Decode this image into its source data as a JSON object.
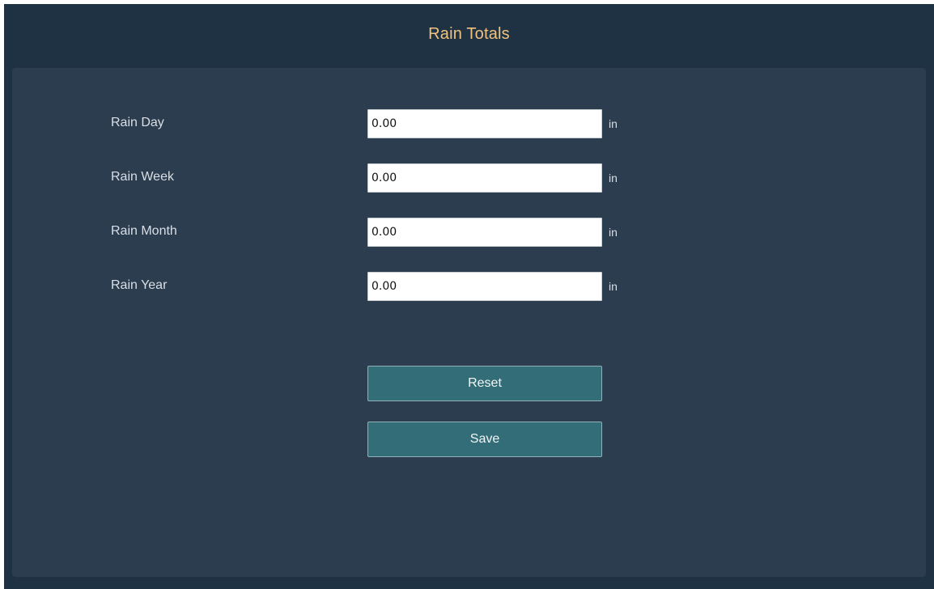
{
  "header": {
    "title": "Rain Totals"
  },
  "form": {
    "fields": [
      {
        "label": "Rain Day",
        "value": "0.00",
        "unit": "in"
      },
      {
        "label": "Rain Week",
        "value": "0.00",
        "unit": "in"
      },
      {
        "label": "Rain Month",
        "value": "0.00",
        "unit": "in"
      },
      {
        "label": "Rain Year",
        "value": "0.00",
        "unit": "in"
      }
    ],
    "reset_label": "Reset",
    "save_label": "Save"
  },
  "colors": {
    "window_background": "#1f3243",
    "panel_background": "#2c3d4f",
    "title_accent": "#f0c27f",
    "button_background": "#336d77"
  }
}
